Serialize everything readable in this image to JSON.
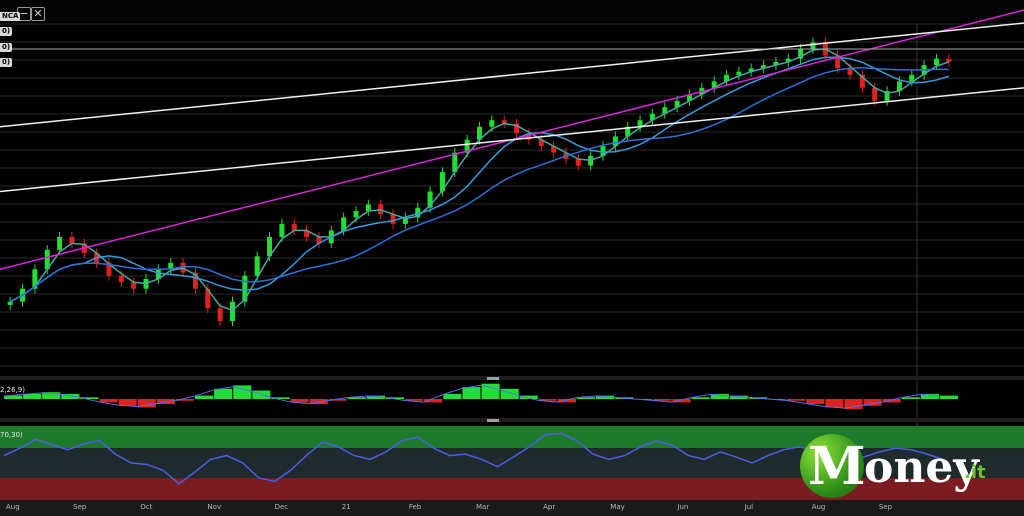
{
  "toolbar": {
    "btn1": "−",
    "btn2": "✕"
  },
  "tags": [
    "NCA",
    "0)",
    "0)",
    "0)"
  ],
  "macd_label": "2,26,9)",
  "stoch_label": "70,30)",
  "logo": {
    "text": "oney",
    "initial": "M",
    "tld": ".it"
  },
  "colors": {
    "up": "#22dd33",
    "down": "#dd2222",
    "sma_fast": "#4aa8a0",
    "sma_mid": "#3a9ad9",
    "sma_slow": "#2f6fd6",
    "trend": "#d626d6",
    "channel": "#f0f0f0",
    "osc": "#4a5ee8"
  },
  "chart_data": [
    {
      "type": "candlestick",
      "title": "",
      "x_ticks": [
        "Aug",
        "Sep",
        "Oct",
        "Nov",
        "Dec",
        "21",
        "Feb",
        "Mar",
        "Apr",
        "May",
        "Jun",
        "Jul",
        "Aug",
        "Sep"
      ],
      "ylim": [
        0,
        100
      ],
      "closes": [
        18,
        22,
        28,
        34,
        38,
        36,
        33,
        30,
        26,
        24,
        22,
        25,
        28,
        30,
        27,
        22,
        16,
        12,
        18,
        26,
        32,
        38,
        42,
        40,
        38,
        36,
        40,
        44,
        46,
        48,
        45,
        42,
        44,
        47,
        52,
        58,
        64,
        68,
        72,
        74,
        73,
        70,
        68,
        66,
        64,
        62,
        60,
        63,
        66,
        69,
        72,
        74,
        76,
        78,
        80,
        82,
        84,
        86,
        88,
        89,
        90,
        91,
        92,
        93,
        96,
        98,
        94,
        90,
        88,
        84,
        80,
        83,
        86,
        88,
        91,
        93,
        92
      ],
      "moving_averages": [
        "SMA fast",
        "SMA mid",
        "SMA slow"
      ],
      "overlays": [
        "trend line",
        "upper channel",
        "lower channel"
      ]
    },
    {
      "type": "histogram",
      "title": "",
      "values": [
        0.2,
        0.3,
        0.4,
        0.3,
        0.1,
        -0.2,
        -0.4,
        -0.5,
        -0.3,
        -0.1,
        0.2,
        0.6,
        0.8,
        0.5,
        0.1,
        -0.2,
        -0.3,
        -0.1,
        0.1,
        0.2,
        0.1,
        -0.1,
        -0.2,
        0.3,
        0.7,
        0.9,
        0.6,
        0.2,
        -0.1,
        -0.2,
        0.1,
        0.2,
        0.1,
        0.0,
        -0.1,
        -0.2,
        0.1,
        0.3,
        0.2,
        0.1,
        0.0,
        -0.1,
        -0.3,
        -0.5,
        -0.6,
        -0.4,
        -0.2,
        0.1,
        0.3,
        0.2
      ]
    },
    {
      "type": "line",
      "title": "",
      "ylim": [
        0,
        100
      ],
      "bands": [
        70,
        30
      ],
      "values": [
        60,
        70,
        82,
        75,
        68,
        76,
        80,
        62,
        50,
        48,
        40,
        22,
        38,
        55,
        60,
        50,
        30,
        25,
        40,
        60,
        78,
        72,
        60,
        55,
        65,
        80,
        85,
        70,
        60,
        62,
        55,
        45,
        58,
        72,
        88,
        90,
        80,
        62,
        55,
        60,
        72,
        80,
        74,
        60,
        55,
        65,
        58,
        50,
        60,
        68,
        72,
        66,
        60,
        52,
        58,
        65,
        70,
        68,
        62,
        55
      ]
    }
  ]
}
